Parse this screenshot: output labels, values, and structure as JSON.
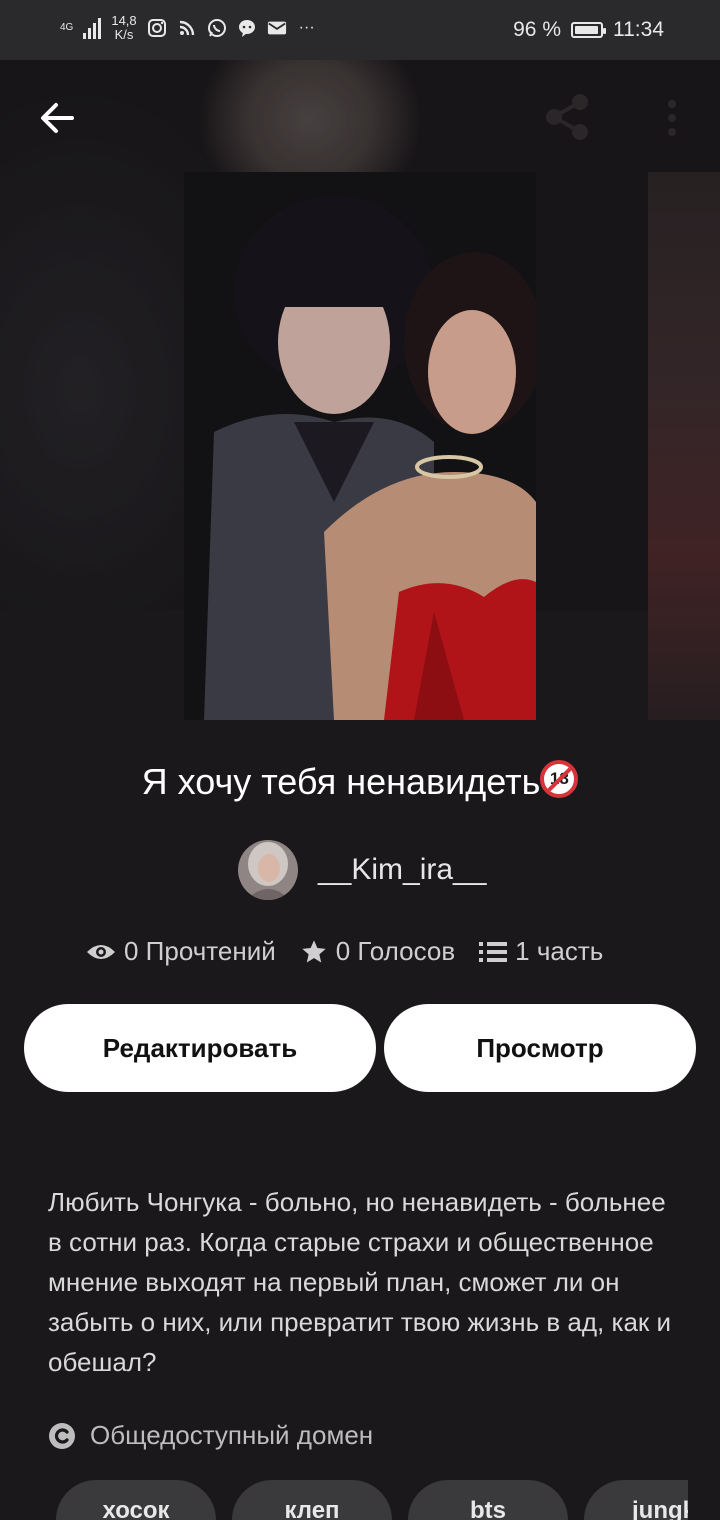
{
  "status_bar": {
    "network": "4G",
    "speed_value": "14,8",
    "speed_unit": "K/s",
    "battery": "96 %",
    "battery_level": 0.96,
    "time": "11:34",
    "app_icons": [
      "instagram-icon",
      "rss-icon",
      "whatsapp-icon",
      "message-bubble-icon",
      "mail-icon",
      "more-notifications-icon"
    ],
    "overflow": "···"
  },
  "toolbar": {
    "back_icon": "back-arrow-icon",
    "share_icon": "share-icon",
    "more_icon": "more-vertical-icon"
  },
  "story": {
    "title": "Я хочу тебя ненавидеть",
    "age_badge": "18",
    "author": "__Kim_ira__",
    "stats": {
      "reads": "0 Прочтений",
      "votes": "0 Голосов",
      "parts": "1 часть"
    },
    "description": "Любить Чонгука - больно, но ненавидеть - больнее в сотни раз. Когда старые страхи и общественное мнение выходят на первый план, сможет ли он забыть о них, или превратит твою жизнь в ад, как и обешал?",
    "license": "Общедоступный домен",
    "tags": [
      "хосок",
      "клеп",
      "bts",
      "jungk"
    ]
  },
  "actions": {
    "edit_label": "Редактировать",
    "view_label": "Просмотр"
  }
}
